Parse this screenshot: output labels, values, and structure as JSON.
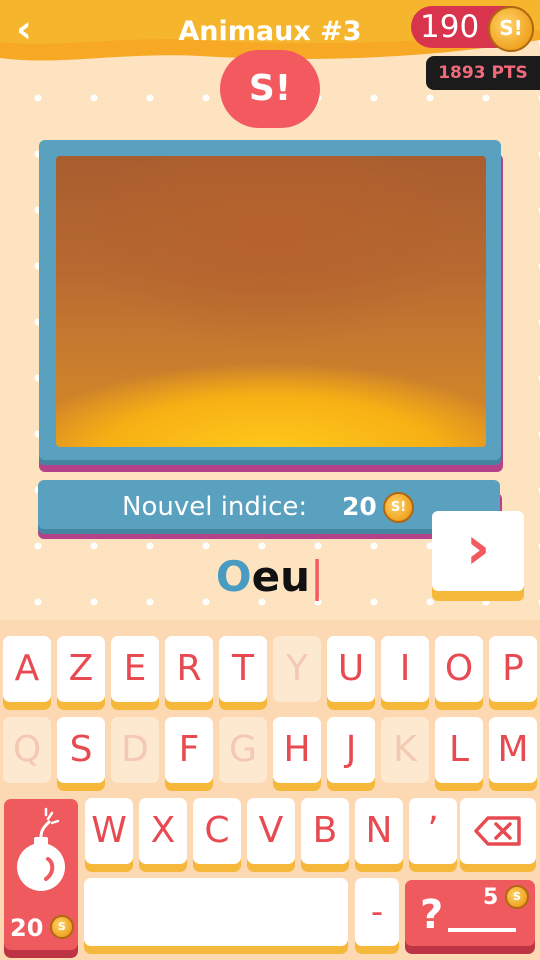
{
  "header": {
    "back_icon": "chevron-left-icon",
    "title": "Animaux #3",
    "coins": "190",
    "coin_icon": "coin-icon",
    "points": "1893 PTS"
  },
  "logo": {
    "text": "S!"
  },
  "hint": {
    "label": "Nouvel indice:",
    "cost": "20"
  },
  "answer": {
    "first_letter": "O",
    "rest": "eu",
    "caret": "|"
  },
  "next_button": {
    "icon": "chevron-right-icon",
    "glyph": "›"
  },
  "keyboard": {
    "row1": [
      {
        "label": "A",
        "enabled": true
      },
      {
        "label": "Z",
        "enabled": true
      },
      {
        "label": "E",
        "enabled": true
      },
      {
        "label": "R",
        "enabled": true
      },
      {
        "label": "T",
        "enabled": true
      },
      {
        "label": "Y",
        "enabled": false
      },
      {
        "label": "U",
        "enabled": true
      },
      {
        "label": "I",
        "enabled": true
      },
      {
        "label": "O",
        "enabled": true
      },
      {
        "label": "P",
        "enabled": true
      }
    ],
    "row2": [
      {
        "label": "Q",
        "enabled": false
      },
      {
        "label": "S",
        "enabled": true
      },
      {
        "label": "D",
        "enabled": false
      },
      {
        "label": "F",
        "enabled": true
      },
      {
        "label": "G",
        "enabled": false
      },
      {
        "label": "H",
        "enabled": true
      },
      {
        "label": "J",
        "enabled": true
      },
      {
        "label": "K",
        "enabled": false
      },
      {
        "label": "L",
        "enabled": true
      },
      {
        "label": "M",
        "enabled": true
      }
    ],
    "row3": [
      {
        "label": "W",
        "enabled": true
      },
      {
        "label": "X",
        "enabled": true
      },
      {
        "label": "C",
        "enabled": true
      },
      {
        "label": "V",
        "enabled": true
      },
      {
        "label": "B",
        "enabled": true
      },
      {
        "label": "N",
        "enabled": true
      },
      {
        "label": "’",
        "enabled": true
      }
    ],
    "backspace_icon": "backspace-icon",
    "bomb": {
      "icon": "bomb-icon",
      "cost": "20"
    },
    "dash": "-",
    "reveal": {
      "symbol": "?",
      "cost": "5"
    }
  },
  "colors": {
    "background": "#fde3c0",
    "header_orange": "#f9a525",
    "accent_red": "#ef5a5e",
    "frame_blue": "#5aa0bf",
    "key_text": "#e84a52"
  }
}
